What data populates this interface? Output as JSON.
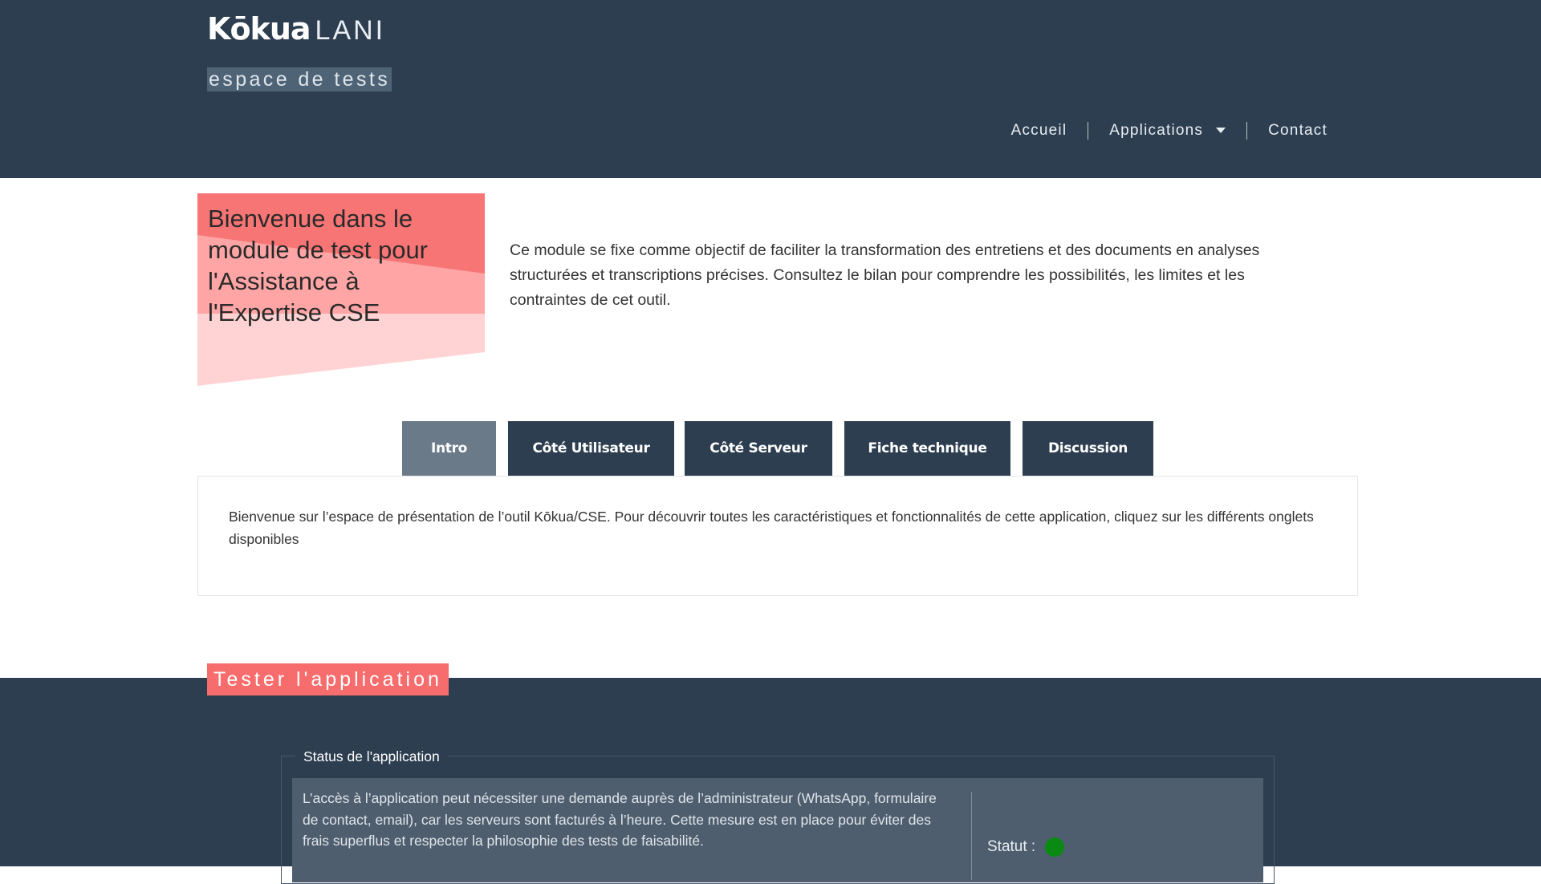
{
  "header": {
    "brand_strong": "Kōkua",
    "brand_light": "LANI",
    "tagline": "espace de tests",
    "nav": {
      "home": "Accueil",
      "applications": "Applications",
      "contact": "Contact"
    }
  },
  "hero": {
    "title": "Bienvenue dans le module de test pour l'Assistance à l'Expertise CSE",
    "description": "Ce module se fixe comme objectif de faciliter la transformation des entretiens et des documents en analyses structurées et transcriptions précises. Consultez le bilan pour comprendre les possibilités, les limites et les contraintes de cet outil."
  },
  "tabs": [
    {
      "label": "Intro",
      "active": true
    },
    {
      "label": "Côté Utilisateur",
      "active": false
    },
    {
      "label": "Côté Serveur",
      "active": false
    },
    {
      "label": "Fiche technique",
      "active": false
    },
    {
      "label": "Discussion",
      "active": false
    }
  ],
  "tab_panel": {
    "text": "Bienvenue sur l’espace de présentation de l’outil Kōkua/CSE. Pour découvrir toutes les caractéristiques et fonctionnalités de cette application, cliquez sur les différents onglets disponibles"
  },
  "test_section": {
    "heading": "Tester l'application",
    "legend": "Status de l'application",
    "description": "L’accès à l’application peut nécessiter une demande auprès de l’administrateur (WhatsApp, formulaire de contact, email), car les serveurs sont facturés à l’heure. Cette mesure est en place pour éviter des frais superflus et respecter la philosophie des tests de faisabilité.",
    "status_label": "Statut :",
    "status_color": "#0a8a12"
  },
  "colors": {
    "header_bg": "#2d3e50",
    "accent": "#f76c6c",
    "tab_active": "#6b7a89"
  }
}
